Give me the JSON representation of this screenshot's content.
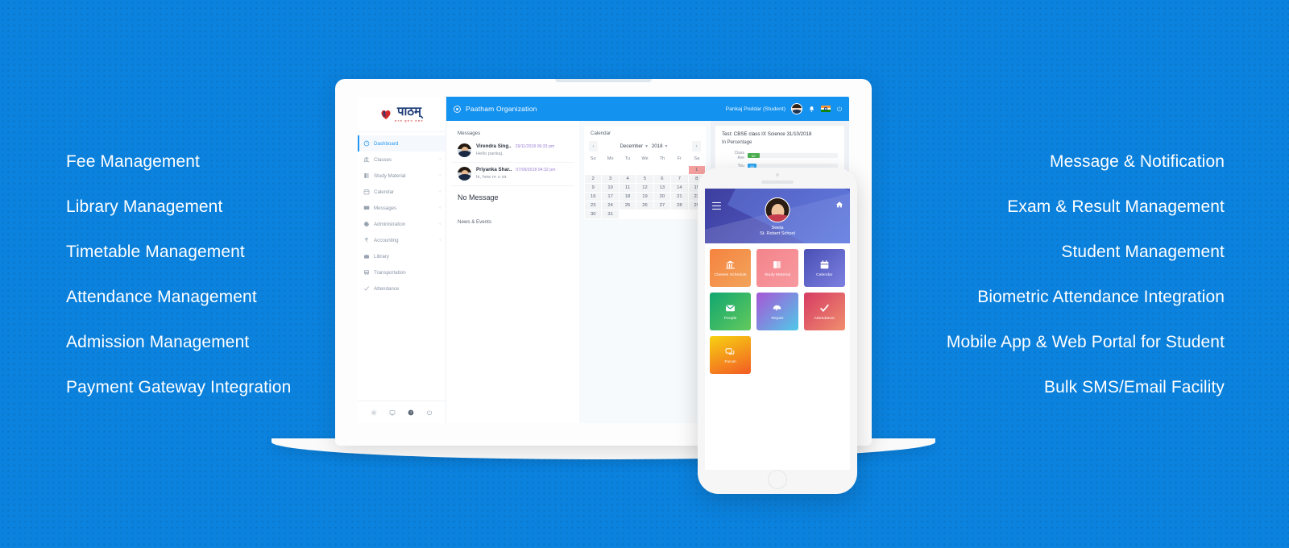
{
  "background": {
    "color": "#0b82de"
  },
  "features": {
    "left": [
      "Fee Management",
      "Library Management",
      "Timetable Management",
      "Attendance Management",
      "Admission Management",
      "Payment Gateway Integration"
    ],
    "right": [
      "Message & Notification",
      "Exam & Result Management",
      "Student Management",
      "Biometric Attendance Integration",
      "Mobile App & Web Portal for Student",
      "Bulk SMS/Email Facility"
    ]
  },
  "laptop": {
    "logo": {
      "word": "पाठम्",
      "tagline": "सरल  सुलभ  सक्षम",
      "icon": "paatham-logo-icon"
    },
    "topbar": {
      "org_title": "Paatham Organization",
      "user_name": "Pankaj Poddar (Student)",
      "icons": [
        "target-icon",
        "user-avatar",
        "bell-icon",
        "india-flag-icon",
        "power-icon"
      ],
      "color": "#1492f0"
    },
    "sidebar": {
      "items": [
        {
          "label": "Dashboard",
          "icon": "dashboard-icon",
          "active": true,
          "caret": false
        },
        {
          "label": "Classes",
          "icon": "bank-icon",
          "active": false,
          "caret": true
        },
        {
          "label": "Study Material",
          "icon": "book-icon",
          "active": false,
          "caret": true
        },
        {
          "label": "Calendar",
          "icon": "calendar-icon",
          "active": false,
          "caret": true
        },
        {
          "label": "Messages",
          "icon": "message-icon",
          "active": false,
          "caret": true
        },
        {
          "label": "Administration",
          "icon": "gear-icon",
          "active": false,
          "caret": true
        },
        {
          "label": "Accounting",
          "icon": "rupee-icon",
          "active": false,
          "caret": true
        },
        {
          "label": "Library",
          "icon": "library-icon",
          "active": false,
          "caret": false
        },
        {
          "label": "Transportation",
          "icon": "bus-icon",
          "active": false,
          "caret": false
        },
        {
          "label": "Attendance",
          "icon": "check-icon",
          "active": false,
          "caret": false
        }
      ],
      "footer_icons": [
        "settings-icon",
        "screen-icon",
        "help-icon",
        "power-icon"
      ],
      "caret_glyph": "‹"
    },
    "messages_panel": {
      "title": "Messages",
      "items": [
        {
          "name": "Virendra Sing..",
          "time": "29/11/2018 06:33 pm",
          "preview": "Hello pankaj.."
        },
        {
          "name": "Priyanka Shar..",
          "time": "07/09/2018 04:32 pm",
          "preview": "hi, how nr u sir."
        }
      ],
      "empty_state": "No Message"
    },
    "news_panel": {
      "title": "News & Events"
    },
    "calendar": {
      "title": "Calendar",
      "month": "December",
      "year": "2018",
      "prev_glyph": "‹",
      "next_glyph": "›",
      "weekdays": [
        "Su",
        "Mo",
        "Tu",
        "We",
        "Th",
        "Fr",
        "Sa"
      ],
      "weeks": [
        [
          "",
          "",
          "",
          "",
          "",
          "",
          "1"
        ],
        [
          "2",
          "3",
          "4",
          "5",
          "6",
          "7",
          "8"
        ],
        [
          "9",
          "10",
          "11",
          "12",
          "13",
          "14",
          "15"
        ],
        [
          "16",
          "17",
          "18",
          "19",
          "20",
          "21",
          "22"
        ],
        [
          "23",
          "24",
          "25",
          "26",
          "27",
          "28",
          "29"
        ],
        [
          "30",
          "31",
          "",
          "",
          "",
          "",
          ""
        ]
      ],
      "highlight_day": "1",
      "highlight_color": "#f6a0a0"
    },
    "test_panel": {
      "title": "Test: CBSE class IX Science 31/10/2018",
      "subtitle": "In Percentage",
      "bars": [
        {
          "label": "Class Ave",
          "value": "60",
          "percent": 13,
          "color": "#4caf50"
        },
        {
          "label": "You",
          "value": "50",
          "percent": 10,
          "color": "#29a5f0"
        }
      ]
    }
  },
  "phone": {
    "header": {
      "student_name": "Sweta",
      "school_name": "St. Robert School",
      "menu_icon": "hamburger-icon",
      "home_icon": "home-icon"
    },
    "tiles": [
      {
        "label": "Classes Schedule",
        "icon": "bank-icon",
        "color_from": "#f5833f",
        "color_to": "#f2a45c"
      },
      {
        "label": "Study Material",
        "icon": "book-icon",
        "color_from": "#f4848b",
        "color_to": "#f79aa0"
      },
      {
        "label": "Calendar",
        "icon": "calendar-icon",
        "color_from": "#4a4fb5",
        "color_to": "#7b80e0"
      },
      {
        "label": "People",
        "icon": "envelope-icon",
        "color_from": "#11a770",
        "color_to": "#63c95c"
      },
      {
        "label": "Report",
        "icon": "gauge-icon",
        "color_from": "#a855d6",
        "color_to": "#4fc9e8"
      },
      {
        "label": "Attendance",
        "icon": "check-icon",
        "color_from": "#d63b63",
        "color_to": "#f08f6e"
      },
      {
        "label": "Forum",
        "icon": "chat-icon",
        "color_from": "#f7d211",
        "color_to": "#f25b24"
      }
    ]
  }
}
